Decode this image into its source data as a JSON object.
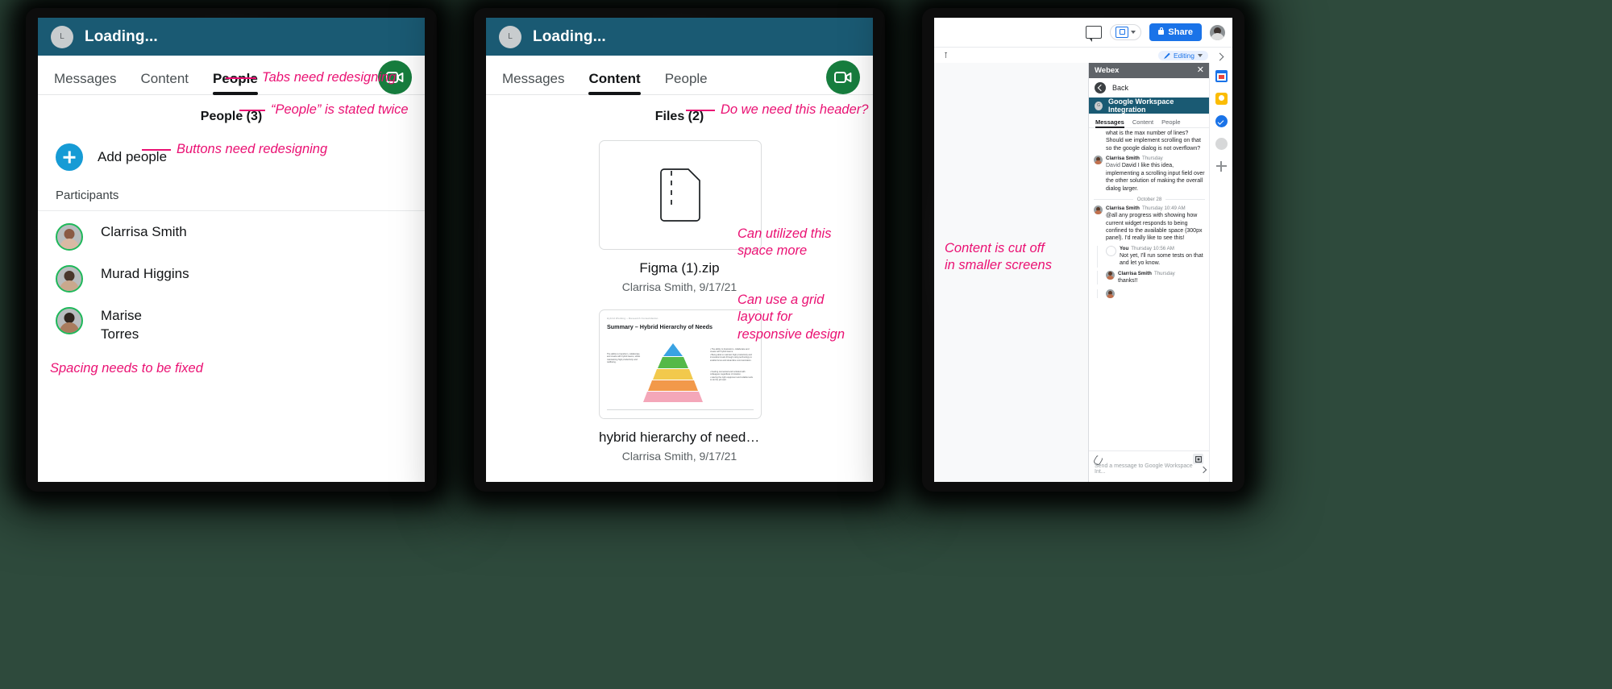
{
  "colors": {
    "webex_header": "#1a5a73",
    "annotation_pink": "#ea1173",
    "call_green": "#177d3e",
    "add_blue": "#169bd5",
    "presence_green": "#1fb85a",
    "google_blue": "#1a73e8",
    "backdrop_green": "#2e4a3c"
  },
  "panel1": {
    "header": {
      "avatar_initial": "L",
      "title": "Loading..."
    },
    "tabs": [
      {
        "label": "Messages",
        "active": false
      },
      {
        "label": "Content",
        "active": false
      },
      {
        "label": "People",
        "active": true
      }
    ],
    "call_button_icon": "video-camera-icon",
    "section_header": "People (3)",
    "add_people_label": "Add people",
    "add_icon": "plus-icon",
    "participants_label": "Participants",
    "participants": [
      {
        "name": "Clarrisa Smith",
        "status": "available"
      },
      {
        "name": "Murad Higgins",
        "status": "available"
      },
      {
        "name": "Marise Torres",
        "status": "available"
      }
    ],
    "annotations": [
      {
        "id": "tabs",
        "text": "Tabs need redesigning"
      },
      {
        "id": "people-twice",
        "text": "“People” is stated twice"
      },
      {
        "id": "buttons",
        "text": "Buttons need redesigning"
      },
      {
        "id": "spacing",
        "text": "Spacing needs to be fixed"
      }
    ]
  },
  "panel2": {
    "header": {
      "avatar_initial": "L",
      "title": "Loading..."
    },
    "tabs": [
      {
        "label": "Messages",
        "active": false
      },
      {
        "label": "Content",
        "active": true
      },
      {
        "label": "People",
        "active": false
      }
    ],
    "call_button_icon": "video-camera-icon",
    "section_header": "Files (2)",
    "files": [
      {
        "name": "Figma (1).zip",
        "meta": "Clarrisa Smith, 9/17/21",
        "thumb": "zip-file-icon"
      },
      {
        "name": "hybrid hierarchy of needs...",
        "meta": "Clarrisa Smith, 9/17/21",
        "thumb": "slide-preview"
      }
    ],
    "slide_preview": {
      "kicker": "Hybrid Working – Research Consolidation",
      "title": "Summary – Hybrid Hierarchy of Needs",
      "layers": [
        "Thrive",
        "Collaborate",
        "Belonging",
        "Connect",
        "Foundation"
      ],
      "layer_colors": [
        "#3aa3e3",
        "#55b948",
        "#f2c94c",
        "#f2994a",
        "#f4a7b9"
      ]
    },
    "annotations": [
      {
        "id": "header-need",
        "text": "Do we need this header?"
      },
      {
        "id": "utilize-space",
        "text": "Can utilized this space more"
      },
      {
        "id": "grid-layout",
        "text": "Can use a grid layout for responsive design"
      }
    ]
  },
  "panel3": {
    "gdocs_toolbar": {
      "comment_icon": "comment-icon",
      "meet_icon": "meet-camera-icon",
      "meet_caret_icon": "chevron-down-icon",
      "share_label": "Share",
      "share_lock_icon": "lock-icon",
      "avatar": "user-avatar",
      "mode_label": "Editing",
      "mode_icon": "pencil-icon",
      "mode_caret_icon": "chevron-down-icon",
      "collapse_icon": "chevron-up-icon",
      "cursor_icon": "text-cursor-icon"
    },
    "webex_panel": {
      "title": "Webex",
      "close_icon": "close-icon",
      "back_label": "Back",
      "back_icon": "chevron-left-icon",
      "space": {
        "avatar_initial": "G",
        "name": "Google Workspace Integration"
      },
      "tabs": [
        {
          "label": "Messages",
          "active": true
        },
        {
          "label": "Content",
          "active": false
        },
        {
          "label": "People",
          "active": false
        }
      ],
      "messages": [
        {
          "kind": "text-only",
          "text": "what is the max number of lines? Should we implement scrolling on that so the google dialog is not overflown?"
        },
        {
          "kind": "reply",
          "author": "Clarrisa Smith",
          "time": "Thursday",
          "text": "David I like this idea, implementing a scrolling input field over the other solution of making the overall dialog larger.",
          "mention": "David"
        },
        {
          "kind": "day-separator",
          "text": "October 28"
        },
        {
          "kind": "message",
          "author": "Clarrisa Smith",
          "time": "Thursday 10:49 AM",
          "text": "@all any progress with showing how current widget responds to being confined to the available space (300px panel). I'd really like to see this!"
        },
        {
          "kind": "reply",
          "author": "You",
          "time": "Thursday 10:56 AM",
          "text": "Not yet, I'll run some tests on that and let yo know."
        },
        {
          "kind": "reply",
          "author": "Clarrisa Smith",
          "time": "Thursday",
          "text": "thanks!!"
        }
      ],
      "compose_placeholder": "Send a message to Google Workspace Int...",
      "attach_icon": "paperclip-icon",
      "expand_icon": "expand-icon"
    },
    "side_rail_icons": [
      "calendar-icon",
      "keep-icon",
      "tasks-icon",
      "contacts-icon",
      "add-on-icon"
    ],
    "annotation": {
      "id": "cutoff",
      "text": "Content is cut off in smaller screens"
    }
  }
}
